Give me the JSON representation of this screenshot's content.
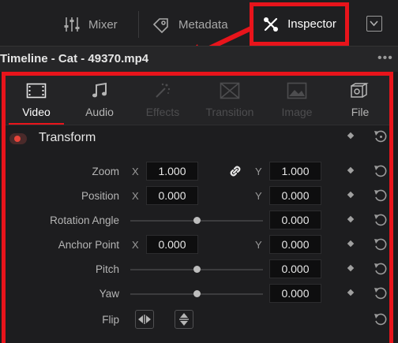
{
  "toolbar": {
    "mixer_label": "Mixer",
    "metadata_label": "Metadata",
    "inspector_label": "Inspector"
  },
  "timeline": {
    "title": "Timeline - Cat - 49370.mp4",
    "more": "•••"
  },
  "tabs": [
    {
      "label": "Video",
      "state": "active",
      "icon": "video-icon"
    },
    {
      "label": "Audio",
      "state": "enabled",
      "icon": "audio-icon"
    },
    {
      "label": "Effects",
      "state": "disabled",
      "icon": "effects-icon"
    },
    {
      "label": "Transition",
      "state": "disabled",
      "icon": "transition-icon"
    },
    {
      "label": "Image",
      "state": "disabled",
      "icon": "image-icon"
    },
    {
      "label": "File",
      "state": "enabled",
      "icon": "file-icon"
    }
  ],
  "section": {
    "title": "Transform",
    "enabled": true
  },
  "rows": {
    "zoom": {
      "label": "Zoom",
      "x_axis": "X",
      "y_axis": "Y",
      "x": "1.000",
      "y": "1.000"
    },
    "position": {
      "label": "Position",
      "x_axis": "X",
      "y_axis": "Y",
      "x": "0.000",
      "y": "0.000"
    },
    "rotation": {
      "label": "Rotation Angle",
      "value": "0.000",
      "slider_fraction": 0.5
    },
    "anchor": {
      "label": "Anchor Point",
      "x_axis": "X",
      "y_axis": "Y",
      "x": "0.000",
      "y": "0.000"
    },
    "pitch": {
      "label": "Pitch",
      "value": "0.000",
      "slider_fraction": 0.5
    },
    "yaw": {
      "label": "Yaw",
      "value": "0.000",
      "slider_fraction": 0.5
    },
    "flip": {
      "label": "Flip"
    }
  },
  "colors": {
    "highlight": "#e8141b",
    "background": "#1c1c1e",
    "accent_toggle": "#e8443a"
  }
}
